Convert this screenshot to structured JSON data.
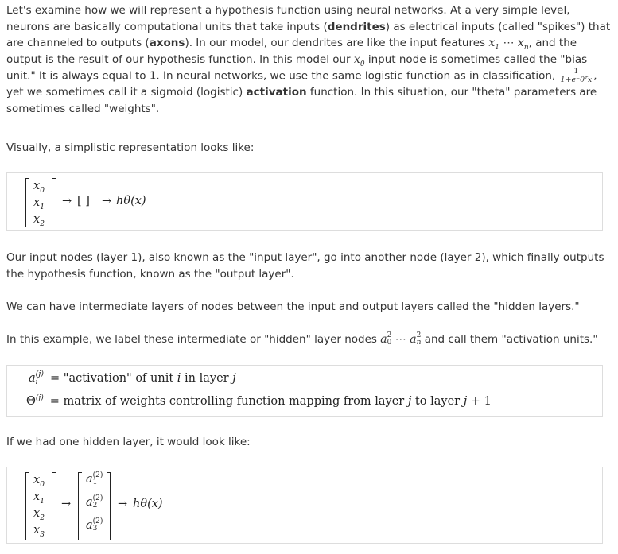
{
  "p1": {
    "a": "Let's examine how we will represent a hypothesis function using neural networks. At a very simple level, neurons are basically computational units that take inputs (",
    "dendrites": "dendrites",
    "b": ") as electrical inputs (called \"spikes\") that are channeled to outputs (",
    "axons": "axons",
    "c": "). In our model, our dendrites are like the input features ",
    "x1": "x",
    "x1_sub": "1",
    "dots": " ⋯ ",
    "xn": "x",
    "xn_sub": "n",
    "d": ", and the output is the result of our hypothesis function. In this model our ",
    "x0": "x",
    "x0_sub": "0",
    "e": " input node is sometimes called the \"bias unit.\" It is always equal to 1. In neural networks, we use the same logistic function as in classification, ",
    "frac_num": "1",
    "frac_den": "1+e⁻θᵀx",
    "f": ", yet we sometimes call it a sigmoid (logistic) ",
    "activation": "activation",
    "g": " function. In this situation, our \"theta\" parameters are sometimes called \"weights\"."
  },
  "p2": "Visually, a simplistic representation looks like:",
  "box1": {
    "inputs": [
      "x",
      "x",
      "x"
    ],
    "input_subs": [
      "0",
      "1",
      "2"
    ],
    "arrow1": "→",
    "empty_bracket": "[  ]",
    "arrow2": "→",
    "output": "hθ(x)"
  },
  "p3": "Our input nodes (layer 1), also known as the \"input layer\", go into another node (layer 2), which finally outputs the hypothesis function, known as the \"output layer\".",
  "p4": "We can have intermediate layers of nodes between the input and output layers called the \"hidden layers.\"",
  "p5": {
    "a": "In this example, we label these intermediate or \"hidden\" layer nodes ",
    "a0": "a",
    "a0_sup": "2",
    "a0_sub": "0",
    "dots": " ⋯ ",
    "an": "a",
    "an_sup": "2",
    "an_sub": "n",
    "b": " and call them \"activation units.\""
  },
  "box2": {
    "line1_lhs": "a",
    "line1_sup": "(j)",
    "line1_sub": "i",
    "line1_rhs_a": "= \"activation\" of unit ",
    "line1_i": "i",
    "line1_rhs_b": " in layer ",
    "line1_j": "j",
    "line2_lhs": "Θ",
    "line2_sup": "(j)",
    "line2_rhs_a": "= matrix of weights controlling function mapping from layer ",
    "line2_j": "j",
    "line2_rhs_b": " to layer ",
    "line2_j2": "j",
    "line2_rhs_c": " + 1"
  },
  "p6": "If we had one hidden layer, it would look like:",
  "box3": {
    "inputs": [
      "x",
      "x",
      "x",
      "x"
    ],
    "input_subs": [
      "0",
      "1",
      "2",
      "3"
    ],
    "arrow1": "→",
    "hidden": [
      "a",
      "a",
      "a"
    ],
    "hidden_sups": [
      "(2)",
      "(2)",
      "(2)"
    ],
    "hidden_subs": [
      "1",
      "2",
      "3"
    ],
    "arrow2": "→",
    "output": "hθ(x)"
  }
}
